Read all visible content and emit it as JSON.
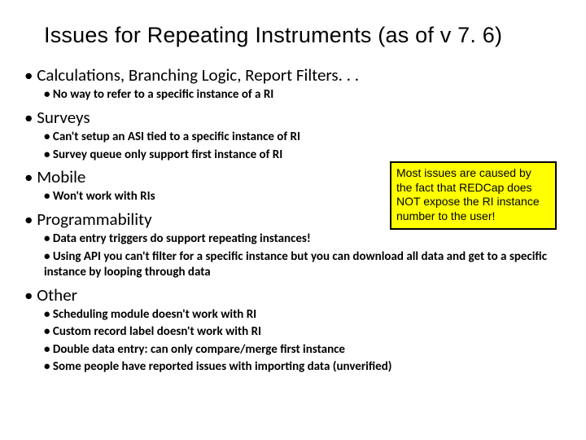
{
  "title": "Issues for Repeating Instruments (as of v 7. 6)",
  "sections": {
    "calc": {
      "heading": "Calculations, Branching Logic, Report Filters. . .",
      "items": [
        "No way to refer to a specific instance of a RI"
      ]
    },
    "surveys": {
      "heading": "Surveys",
      "items": [
        "Can't setup an ASI tied to a specific instance of RI",
        "Survey queue only support first instance of RI"
      ]
    },
    "mobile": {
      "heading": "Mobile",
      "items": [
        "Won't work with RIs"
      ]
    },
    "prog": {
      "heading": "Programmability",
      "items": [
        "Data entry triggers do support repeating instances!",
        "Using API you can't filter for a specific instance but you can download all data and get to a specific instance by looping through data"
      ]
    },
    "other": {
      "heading": "Other",
      "items": [
        "Scheduling module doesn't work with RI",
        "Custom record label doesn't work with RI",
        "Double data entry: can only compare/merge first instance",
        "Some people have reported issues with importing data (unverified)"
      ]
    }
  },
  "callout": "Most issues are caused by the fact that REDCap does NOT expose the RI instance number to the user!"
}
